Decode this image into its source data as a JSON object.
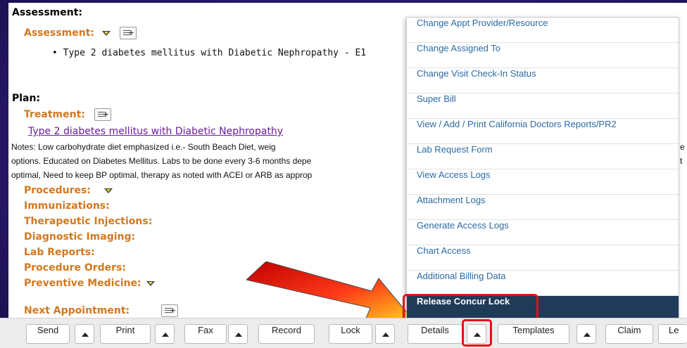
{
  "assessment": {
    "heading": "Assessment:",
    "sub_label": "Assessment:",
    "bullet_text": "•  Type 2 diabetes mellitus with Diabetic Nephropathy - E1"
  },
  "plan": {
    "heading": "Plan:",
    "treatment_label": "Treatment:",
    "treatment_link": "Type 2 diabetes mellitus with Diabetic Nephropathy",
    "notes_line1": "        Notes: Low carbohydrate diet emphasized i.e.- South Beach Diet, weig",
    "notes_line2": "options. Educated on Diabetes Mellitus. Labs to be done every 3-6 months depe",
    "notes_line3": "optimal, Need to keep BP optimal, therapy as noted with ACEI or ARB as approp",
    "sections": [
      "Procedures:",
      "Immunizations:",
      "Therapeutic Injections:",
      "Diagnostic Imaging:",
      "Lab Reports:",
      "Procedure Orders:",
      "Preventive Medicine:",
      "Next Appointment:"
    ]
  },
  "overflow_text": {
    "notes_end1": "e",
    "notes_end2": "t"
  },
  "details_menu": {
    "items": [
      "Change Appt Provider/Resource",
      "Change Assigned To",
      "Change Visit Check-In Status",
      "Super Bill",
      "View / Add / Print California Doctors Reports/PR2",
      "Lab Request Form",
      "View Access Logs",
      "Attachment Logs",
      "Generate Access Logs",
      "Chart Access",
      "Additional Billing Data",
      "Release Concur Lock"
    ],
    "active_item": "Release Concur Lock"
  },
  "toolbar": {
    "send": "Send",
    "print": "Print",
    "fax": "Fax",
    "record": "Record",
    "lock": "Lock",
    "details": "Details",
    "templates": "Templates",
    "claim": "Claim",
    "letters": "Le"
  },
  "colors": {
    "section_orange": "#d2781f",
    "menu_link": "#2b6aa4",
    "menu_active_bg": "#1f3b58",
    "highlight_red": "#e5101a",
    "link_purple": "#6a1b9a"
  }
}
